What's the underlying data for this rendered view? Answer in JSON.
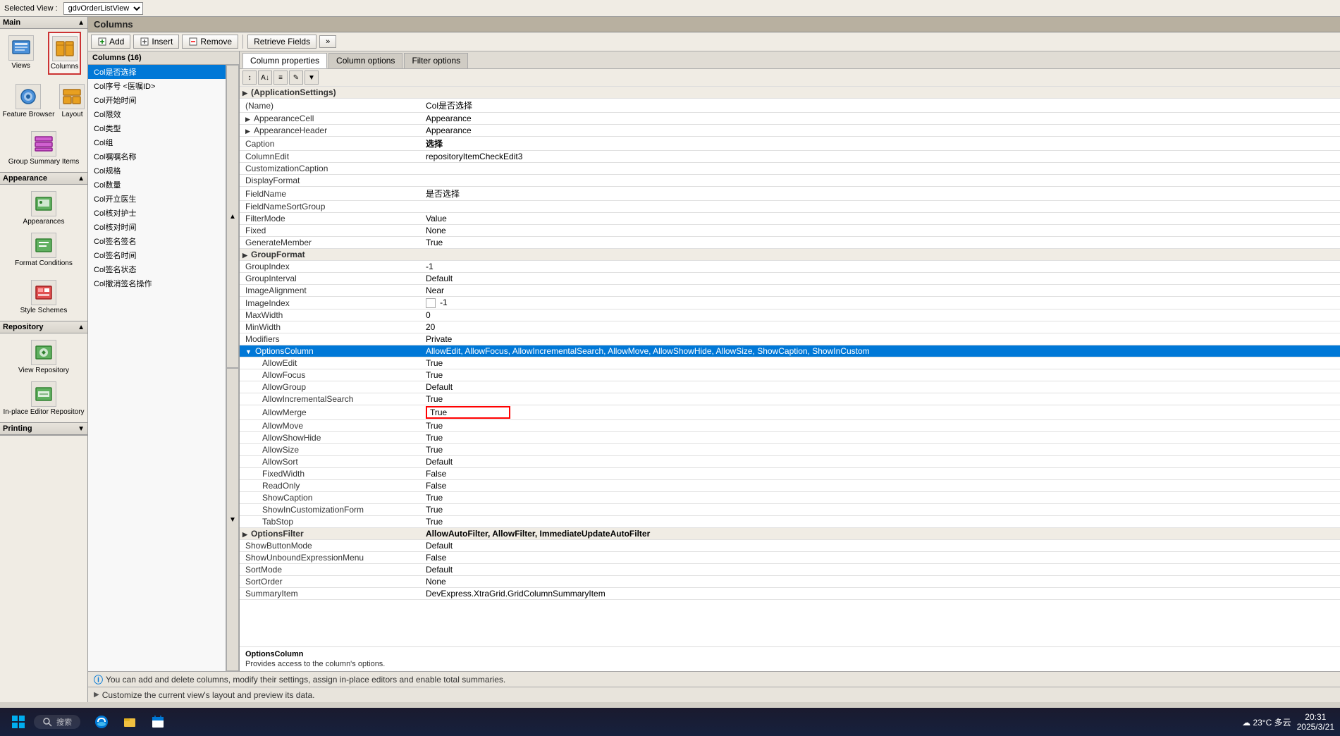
{
  "topBar": {
    "label": "Selected View :",
    "viewValue": "gdvOrderListView"
  },
  "sidebar": {
    "mainSection": {
      "label": "Main",
      "items": [
        {
          "id": "views",
          "label": "Views",
          "selected": false
        },
        {
          "id": "columns",
          "label": "Columns",
          "selected": true
        },
        {
          "id": "feature-browser",
          "label": "Feature Browser",
          "selected": false
        },
        {
          "id": "layout",
          "label": "Layout",
          "selected": false
        },
        {
          "id": "group-summary",
          "label": "Group Summary Items",
          "selected": false
        }
      ]
    },
    "appearanceSection": {
      "label": "Appearance",
      "items": [
        {
          "id": "appearances",
          "label": "Appearances",
          "selected": false
        },
        {
          "id": "format-conditions",
          "label": "Format Conditions",
          "selected": false
        },
        {
          "id": "style-schemes",
          "label": "Style Schemes",
          "selected": false
        }
      ]
    },
    "repositorySection": {
      "label": "Repository",
      "items": [
        {
          "id": "view-repository",
          "label": "View Repository",
          "selected": false
        },
        {
          "id": "inplace-editor",
          "label": "In-place Editor Repository",
          "selected": false
        }
      ]
    },
    "printingSection": {
      "label": "Printing",
      "collapsed": true
    }
  },
  "columnsPanel": {
    "title": "Columns",
    "toolbar": {
      "addLabel": "Add",
      "insertLabel": "Insert",
      "removeLabel": "Remove",
      "retrieveLabel": "Retrieve Fields"
    },
    "columnsHeader": "Columns (16)",
    "columns": [
      {
        "id": 1,
        "name": "Col是否选择",
        "selected": true
      },
      {
        "id": 2,
        "name": "Col序号 <医嘱ID>"
      },
      {
        "id": 3,
        "name": "Col开始时间"
      },
      {
        "id": 4,
        "name": "Col限效"
      },
      {
        "id": 5,
        "name": "Col类型"
      },
      {
        "id": 6,
        "name": "Col组"
      },
      {
        "id": 7,
        "name": "Col嘱嘱名称"
      },
      {
        "id": 8,
        "name": "Col规格"
      },
      {
        "id": 9,
        "name": "Col数量"
      },
      {
        "id": 10,
        "name": "Col开立医生"
      },
      {
        "id": 11,
        "name": "Col核对护士"
      },
      {
        "id": 12,
        "name": "Col核对时间"
      },
      {
        "id": 13,
        "name": "Col签名签名"
      },
      {
        "id": 14,
        "name": "Col签名时间"
      },
      {
        "id": 15,
        "name": "Col签名状态"
      },
      {
        "id": 16,
        "name": "Col撤消签名操作"
      }
    ]
  },
  "propertiesPanel": {
    "tabs": [
      {
        "id": "column-properties",
        "label": "Column properties",
        "active": true
      },
      {
        "id": "column-options",
        "label": "Column options",
        "active": false
      },
      {
        "id": "filter-options",
        "label": "Filter options",
        "active": false
      }
    ],
    "rows": [
      {
        "type": "section",
        "label": "(ApplicationSettings)",
        "expandable": true
      },
      {
        "type": "row",
        "label": "(Name)",
        "value": "Col是否选择"
      },
      {
        "type": "row",
        "label": "AppearanceCell",
        "value": "Appearance"
      },
      {
        "type": "row",
        "label": "AppearanceHeader",
        "value": "Appearance"
      },
      {
        "type": "row",
        "label": "Caption",
        "value": "选择",
        "bold": true
      },
      {
        "type": "row",
        "label": "ColumnEdit",
        "value": "repositoryItemCheckEdit3"
      },
      {
        "type": "row",
        "label": "CustomizationCaption",
        "value": ""
      },
      {
        "type": "row",
        "label": "DisplayFormat",
        "value": ""
      },
      {
        "type": "row",
        "label": "FieldName",
        "value": "是否选择"
      },
      {
        "type": "row",
        "label": "FieldNameSortGroup",
        "value": ""
      },
      {
        "type": "row",
        "label": "FilterMode",
        "value": "Value"
      },
      {
        "type": "row",
        "label": "Fixed",
        "value": "None"
      },
      {
        "type": "row",
        "label": "GenerateMember",
        "value": "True"
      },
      {
        "type": "section",
        "label": "GroupFormat",
        "expandable": true
      },
      {
        "type": "row",
        "label": "GroupIndex",
        "value": "-1"
      },
      {
        "type": "row",
        "label": "GroupInterval",
        "value": "Default"
      },
      {
        "type": "row",
        "label": "ImageAlignment",
        "value": "Near"
      },
      {
        "type": "row",
        "label": "ImageIndex",
        "value": "-1",
        "hasCheck": true
      },
      {
        "type": "row",
        "label": "MaxWidth",
        "value": "0"
      },
      {
        "type": "row",
        "label": "MinWidth",
        "value": "20"
      },
      {
        "type": "row",
        "label": "Modifiers",
        "value": "Private"
      },
      {
        "type": "section-highlighted",
        "label": "OptionsColumn",
        "value": "AllowEdit, AllowFocus, AllowIncrementalSearch, AllowMove, AllowShowHide, AllowSize, ShowCaption, ShowInCustom",
        "expandable": true
      },
      {
        "type": "sub-row",
        "label": "AllowEdit",
        "value": "True"
      },
      {
        "type": "sub-row",
        "label": "AllowFocus",
        "value": "True"
      },
      {
        "type": "sub-row",
        "label": "AllowGroup",
        "value": "Default"
      },
      {
        "type": "sub-row",
        "label": "AllowIncrementalSearch",
        "value": "True"
      },
      {
        "type": "sub-row-highlighted",
        "label": "AllowMerge",
        "value": "True",
        "highlighted": true
      },
      {
        "type": "sub-row",
        "label": "AllowMove",
        "value": "True"
      },
      {
        "type": "sub-row",
        "label": "AllowShowHide",
        "value": "True"
      },
      {
        "type": "sub-row",
        "label": "AllowSize",
        "value": "True"
      },
      {
        "type": "sub-row",
        "label": "AllowSort",
        "value": "Default"
      },
      {
        "type": "sub-row",
        "label": "FixedWidth",
        "value": "False"
      },
      {
        "type": "sub-row",
        "label": "ReadOnly",
        "value": "False"
      },
      {
        "type": "sub-row",
        "label": "ShowCaption",
        "value": "True"
      },
      {
        "type": "sub-row",
        "label": "ShowInCustomizationForm",
        "value": "True"
      },
      {
        "type": "sub-row",
        "label": "TabStop",
        "value": "True"
      },
      {
        "type": "section",
        "label": "OptionsFilter",
        "value": "AllowAutoFilter, AllowFilter, ImmediateUpdateAutoFilter",
        "expandable": true
      },
      {
        "type": "row",
        "label": "ShowButtonMode",
        "value": "Default"
      },
      {
        "type": "row",
        "label": "ShowUnboundExpressionMenu",
        "value": "False"
      },
      {
        "type": "row",
        "label": "SortMode",
        "value": "Default"
      },
      {
        "type": "row",
        "label": "SortOrder",
        "value": "None"
      },
      {
        "type": "row",
        "label": "SummaryItem",
        "value": "DevExpress.XtraGrid.GridColumnSummaryItem"
      }
    ],
    "infoSection": {
      "propName": "OptionsColumn",
      "propDesc": "Provides access to the column's options."
    }
  },
  "statusBar1": "You can add and delete columns, modify their settings, assign in-place editors and enable total summaries.",
  "statusBar2": "Customize the current view's layout and preview its data.",
  "taskbar": {
    "searchPlaceholder": "搜索",
    "time": "20:31",
    "date": "2025/3/21",
    "weather": "23°C",
    "location": "多云"
  }
}
